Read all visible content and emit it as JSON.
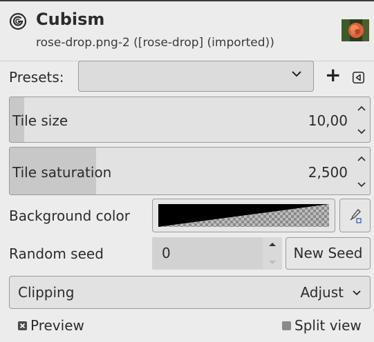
{
  "header": {
    "title": "Cubism",
    "subtitle": "rose-drop.png-2 ([rose-drop] (imported))"
  },
  "presets": {
    "label": "Presets:",
    "value": "",
    "add_symbol": "+"
  },
  "tile_size": {
    "label": "Tile size",
    "value": "10,00",
    "fill_fraction": 0.04
  },
  "tile_saturation": {
    "label": "Tile saturation",
    "value": "2,500",
    "fill_fraction": 0.25
  },
  "background_color": {
    "label": "Background color",
    "color": "#000000"
  },
  "random_seed": {
    "label": "Random seed",
    "value": "0",
    "new_seed_label": "New Seed"
  },
  "clipping": {
    "label": "Clipping",
    "value": "Adjust"
  },
  "preview": {
    "label": "Preview",
    "checked": true
  },
  "split_view": {
    "label": "Split view",
    "checked": false
  },
  "colors": {
    "background": "#ececec",
    "field": "#e2e2e2",
    "slider_fill": "#c8c8c8",
    "text": "#2b2b2b"
  },
  "icons": {
    "filter": "gimp-filter-icon",
    "thumbnail": "image-thumbnail",
    "dropdown": "chevron-down-icon",
    "add": "plus-icon",
    "menu": "triangle-left-icon",
    "spin_up": "chevron-up-icon",
    "spin_down": "chevron-down-icon",
    "picker": "color-picker-icon"
  }
}
